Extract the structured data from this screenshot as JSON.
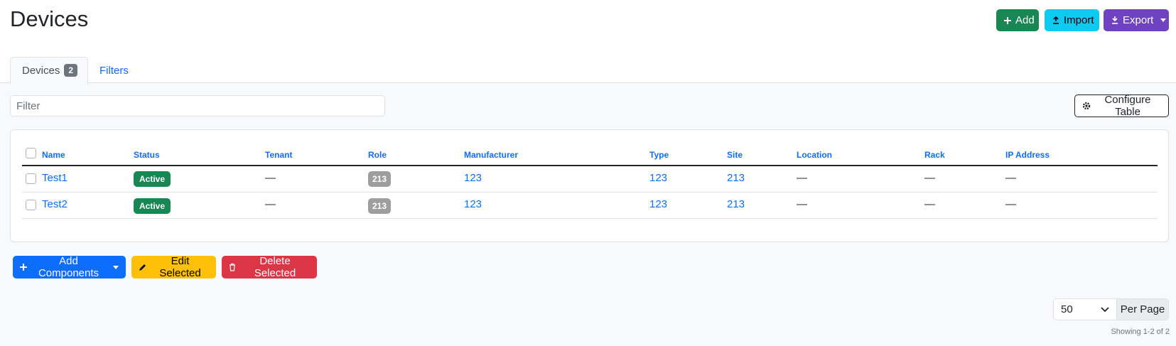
{
  "header": {
    "title": "Devices",
    "add_label": "Add",
    "import_label": "Import",
    "export_label": "Export"
  },
  "tabs": [
    {
      "label": "Devices",
      "count": "2"
    },
    {
      "label": "Filters"
    }
  ],
  "filter": {
    "placeholder": "Filter"
  },
  "configure_label": "Configure Table",
  "table": {
    "columns": [
      "Name",
      "Status",
      "Tenant",
      "Role",
      "Manufacturer",
      "Type",
      "Site",
      "Location",
      "Rack",
      "IP Address"
    ],
    "rows": [
      {
        "name": "Test1",
        "status": "Active",
        "tenant": "—",
        "role": "213",
        "manufacturer": "123",
        "type": "123",
        "site": "213",
        "location": "—",
        "rack": "—",
        "ip": "—"
      },
      {
        "name": "Test2",
        "status": "Active",
        "tenant": "—",
        "role": "213",
        "manufacturer": "123",
        "type": "123",
        "site": "213",
        "location": "—",
        "rack": "—",
        "ip": "—"
      }
    ]
  },
  "actions": {
    "add_components": "Add Components",
    "edit_selected": "Edit Selected",
    "delete_selected": "Delete Selected"
  },
  "pagination": {
    "per_page_value": "50",
    "per_page_label": "Per Page",
    "showing": "Showing 1-2 of 2"
  },
  "colors": {
    "primary": "#0d6efd",
    "success": "#198754",
    "info": "#0dcaf0",
    "purple": "#6f42c1",
    "warning": "#ffc107",
    "danger": "#dc3545"
  }
}
